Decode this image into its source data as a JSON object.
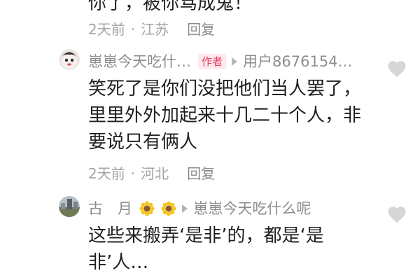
{
  "prev_comment": {
    "text_tail": "你了，被你骂成鬼！",
    "time": "2天前",
    "location": "江苏",
    "reply_label": "回复"
  },
  "comment1": {
    "username": "崽崽今天吃什…",
    "author_badge": "作者",
    "reply_to": "用户8676154…",
    "lines": [
      "笑死了是你们没把他们当人罢了，",
      "里里外外加起来十几二十个人，非",
      "要说只有俩人"
    ],
    "time": "2天前",
    "location": "河北",
    "reply_label": "回复"
  },
  "comment2": {
    "username": "古　月",
    "reply_to": "崽崽今天吃什么呢",
    "lines": [
      "这些来搬弄‘是非’的，都是‘是",
      "非’人…"
    ]
  },
  "colors": {
    "badge_bg": "#fde9ee",
    "badge_text": "#e83a5c",
    "heart": "#d6d6d6"
  }
}
